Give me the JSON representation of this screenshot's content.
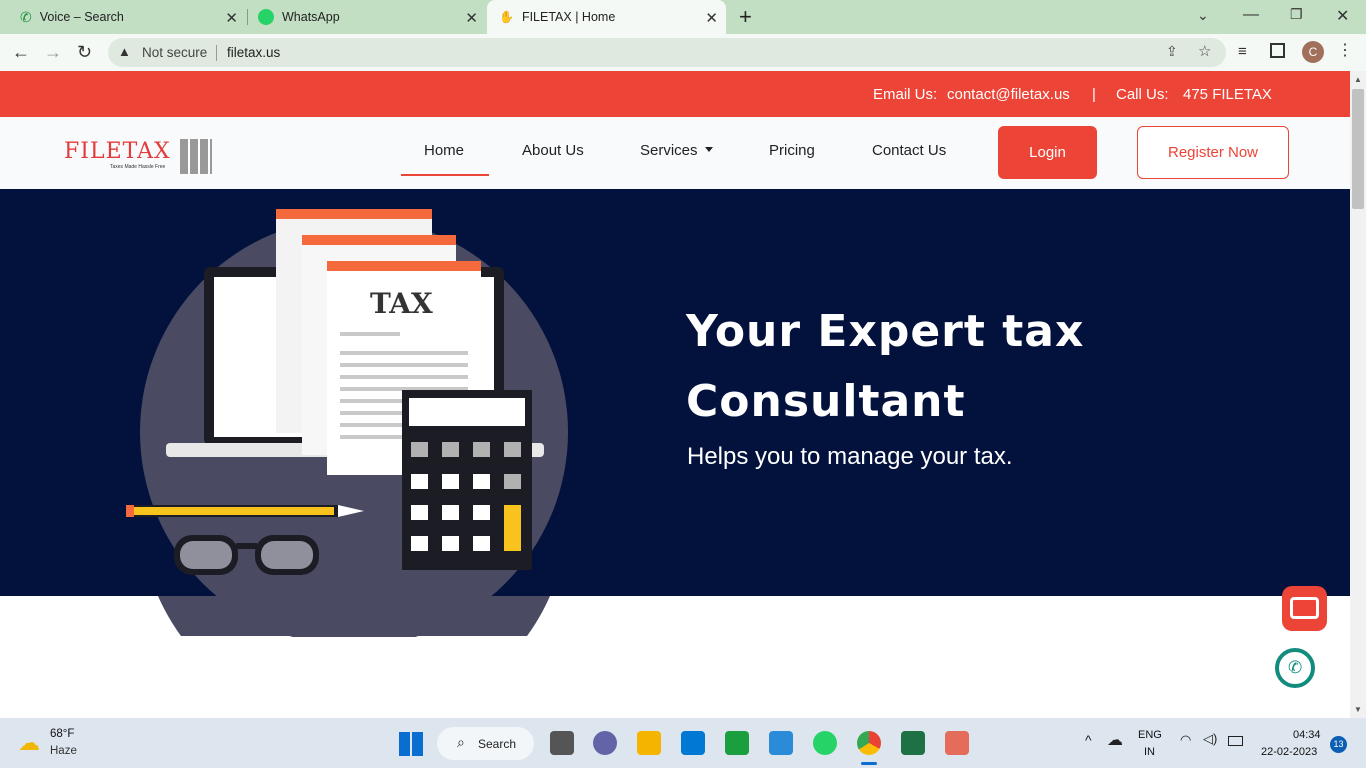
{
  "browser": {
    "tabs": [
      {
        "label": "Voice – Search",
        "icon": "phone-icon"
      },
      {
        "label": "WhatsApp",
        "icon": "whatsapp-icon"
      },
      {
        "label": "FILETAX | Home",
        "icon": "hand-icon"
      }
    ],
    "security_label": "Not secure",
    "url": "filetax.us",
    "profile_initial": "C"
  },
  "site": {
    "email_label": "Email Us:",
    "email": "contact@filetax.us",
    "divider": "|",
    "call_label": "Call Us:",
    "phone": "475 FILETAX",
    "logo_text": "FILETAX",
    "logo_tagline": "Taxes Made Hassle Free",
    "nav": [
      "Home",
      "About Us",
      "Services",
      "Pricing",
      "Contact Us"
    ],
    "login_label": "Login",
    "register_label": "Register Now",
    "hero_title_line1": "Your Expert tax",
    "hero_title_line2": "Consultant",
    "hero_subtitle": "Helps you to manage your tax.",
    "illustration_word": "TAX",
    "colors": {
      "accent": "#ec4436",
      "hero_bg": "#03123d"
    }
  },
  "taskbar": {
    "temperature": "68°F",
    "weather": "Haze",
    "search_label": "Search",
    "lang_line1": "ENG",
    "lang_line2": "IN",
    "time": "04:34",
    "date": "22-02-2023",
    "notification_count": "13"
  }
}
